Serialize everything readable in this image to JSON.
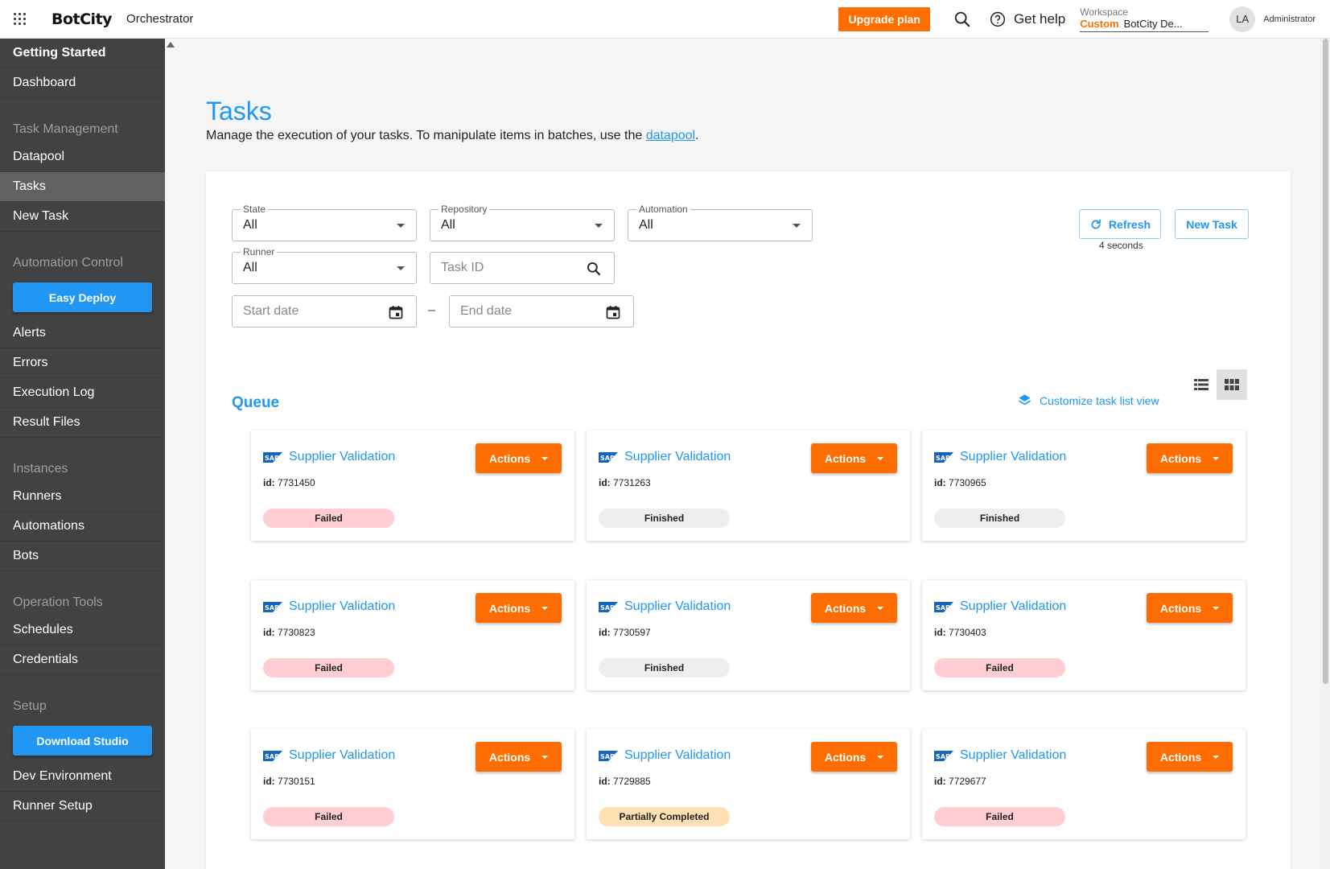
{
  "header": {
    "logo": "BotCity",
    "app_name": "Orchestrator",
    "upgrade_label": "Upgrade plan",
    "help_label": "Get help",
    "workspace_label": "Workspace",
    "workspace_tag": "Custom",
    "workspace_name": "BotCity De...",
    "avatar_initials": "LA",
    "role": "Administrator"
  },
  "sidebar": {
    "getting_started": "Getting Started",
    "dashboard": "Dashboard",
    "task_management": "Task Management",
    "datapool": "Datapool",
    "tasks": "Tasks",
    "new_task": "New Task",
    "automation_control": "Automation Control",
    "easy_deploy": "Easy Deploy",
    "alerts": "Alerts",
    "errors": "Errors",
    "execution_log": "Execution Log",
    "result_files": "Result Files",
    "instances": "Instances",
    "runners": "Runners",
    "automations": "Automations",
    "bots": "Bots",
    "operation_tools": "Operation Tools",
    "schedules": "Schedules",
    "credentials": "Credentials",
    "setup": "Setup",
    "download_studio": "Download Studio",
    "dev_environment": "Dev Environment",
    "runner_setup": "Runner Setup"
  },
  "page": {
    "title": "Tasks",
    "desc_prefix": "Manage the execution of your tasks. To manipulate items in batches, use the ",
    "desc_link": "datapool",
    "desc_suffix": "."
  },
  "filters": {
    "state_label": "State",
    "state_value": "All",
    "repository_label": "Repository",
    "repository_value": "All",
    "automation_label": "Automation",
    "automation_value": "All",
    "runner_label": "Runner",
    "runner_value": "All",
    "task_id_placeholder": "Task ID",
    "start_date_placeholder": "Start date",
    "end_date_placeholder": "End date",
    "range_separator": "–"
  },
  "toolbar": {
    "refresh_label": "Refresh",
    "refresh_time": "4 seconds",
    "new_task_label": "New Task"
  },
  "queue": {
    "title": "Queue",
    "customize_label": "Customize task list view",
    "id_prefix": "id:",
    "actions_label": "Actions",
    "cards": [
      {
        "title": "Supplier Validation",
        "id": "7731450",
        "state": "Failed",
        "state_kind": "failed"
      },
      {
        "title": "Supplier Validation",
        "id": "7731263",
        "state": "Finished",
        "state_kind": "finished"
      },
      {
        "title": "Supplier Validation",
        "id": "7730965",
        "state": "Finished",
        "state_kind": "finished"
      },
      {
        "title": "Supplier Validation",
        "id": "7730823",
        "state": "Failed",
        "state_kind": "failed"
      },
      {
        "title": "Supplier Validation",
        "id": "7730597",
        "state": "Finished",
        "state_kind": "finished"
      },
      {
        "title": "Supplier Validation",
        "id": "7730403",
        "state": "Failed",
        "state_kind": "failed"
      },
      {
        "title": "Supplier Validation",
        "id": "7730151",
        "state": "Failed",
        "state_kind": "failed"
      },
      {
        "title": "Supplier Validation",
        "id": "7729885",
        "state": "Partially Completed",
        "state_kind": "partial"
      },
      {
        "title": "Supplier Validation",
        "id": "7729677",
        "state": "Failed",
        "state_kind": "failed"
      }
    ]
  },
  "colors": {
    "accent": "#2196f3",
    "actions": "#ff6d00",
    "sidebar": "#424242",
    "failed": "#ffcdd2",
    "finished": "#eeeeee",
    "partial": "#ffe0b2"
  }
}
